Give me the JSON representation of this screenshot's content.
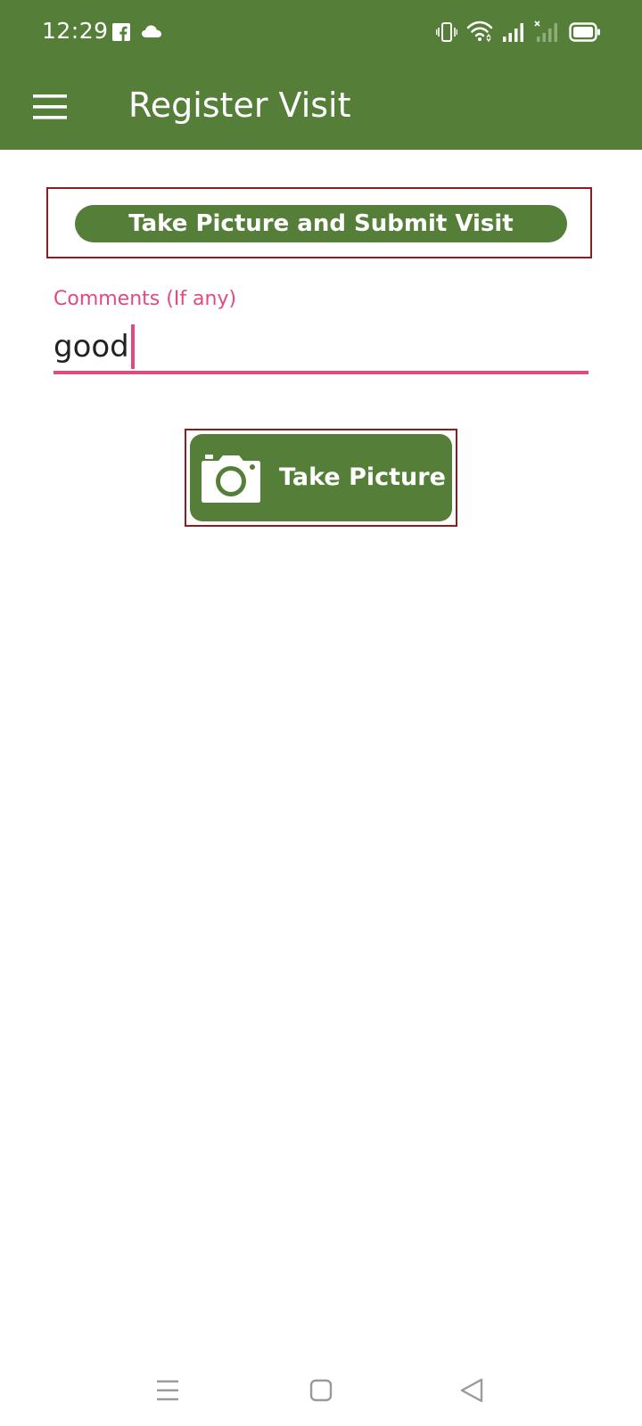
{
  "status_bar": {
    "time": "12:29",
    "notification_icons": [
      "facebook-icon",
      "cloud-icon"
    ],
    "system_icons": [
      "vibrate-icon",
      "wifi-icon",
      "signal-icon",
      "signal-no-service-icon",
      "battery-icon"
    ]
  },
  "app_bar": {
    "title": "Register Visit",
    "menu_icon": "hamburger-menu-icon"
  },
  "form": {
    "submit_button_label": "Take Picture and Submit Visit",
    "comments_label": "Comments (If any)",
    "comments_value": "good",
    "take_picture_label": "Take Picture",
    "take_picture_icon": "camera-icon"
  },
  "nav_bar": {
    "buttons": [
      "recents-icon",
      "home-icon",
      "back-icon"
    ]
  },
  "colors": {
    "primary": "#557f38",
    "accent": "#e2497f",
    "frame": "#8e1c1c"
  }
}
